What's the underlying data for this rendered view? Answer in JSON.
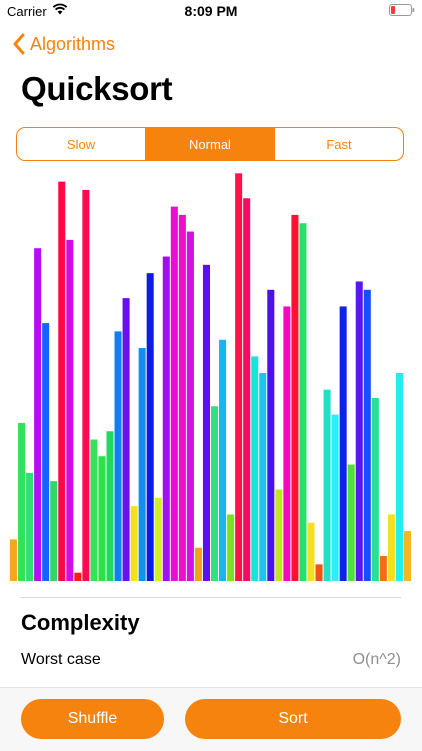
{
  "status": {
    "carrier": "Carrier",
    "time": "8:09 PM",
    "wifi_icon": "wifi-icon",
    "battery_icon": "battery-icon",
    "battery_color": "#ff3b30"
  },
  "nav": {
    "back_label": "Algorithms",
    "back_icon": "chevron-left-icon"
  },
  "title": "Quicksort",
  "speed": {
    "options": [
      "Slow",
      "Normal",
      "Fast"
    ],
    "selected": "Normal"
  },
  "colors": {
    "accent": "#f5830d"
  },
  "chart_data": {
    "type": "bar",
    "values": [
      5,
      19,
      13,
      40,
      31,
      12,
      48,
      41,
      1,
      47,
      17,
      15,
      18,
      30,
      34,
      9,
      28,
      37,
      10,
      39,
      45,
      44,
      42,
      4,
      38,
      21,
      29,
      8,
      49,
      46,
      27,
      25,
      35,
      11,
      33,
      44,
      43,
      7,
      2,
      23,
      20,
      33,
      14,
      36,
      35,
      22,
      3,
      8,
      25,
      6
    ],
    "colors": [
      "#f5a623",
      "#33e05a",
      "#2fe06e",
      "#b40ff0",
      "#1263ff",
      "#33d468",
      "#ff0846",
      "#d10ce8",
      "#ff1a1a",
      "#ff0a52",
      "#39e05c",
      "#2ee04a",
      "#22d861",
      "#127ef0",
      "#6a0ff0",
      "#f5e020",
      "#168ef0",
      "#0c1be8",
      "#d2f020",
      "#9f10f0",
      "#e80cd6",
      "#ee10c9",
      "#d410e4",
      "#f5a020",
      "#5c0ff0",
      "#33e082",
      "#16b6f0",
      "#7ee022",
      "#ff1248",
      "#f50c62",
      "#18e5d6",
      "#1ec3f0",
      "#4b0ff0",
      "#c0e620",
      "#f00cbd",
      "#ff1230",
      "#26e06a",
      "#f5e020",
      "#f05414",
      "#21e0c6",
      "#28f0ff",
      "#0f22e8",
      "#4fe03c",
      "#5518f0",
      "#1450ff",
      "#26e096",
      "#f56c14",
      "#f5e020",
      "#1ef0f0",
      "#f5b620"
    ],
    "ylim": [
      0,
      50
    ]
  },
  "complexity": {
    "title": "Complexity",
    "worst_label": "Worst case",
    "worst_value": "O(n^2)"
  },
  "actions": {
    "shuffle": "Shuffle",
    "sort": "Sort"
  }
}
